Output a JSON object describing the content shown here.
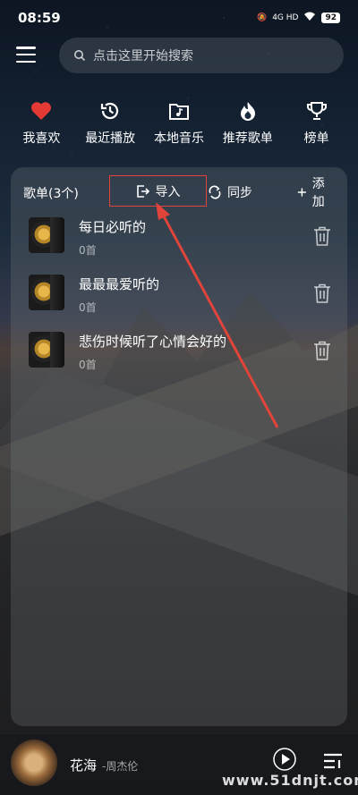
{
  "status": {
    "time": "08:59",
    "network": "4G HD",
    "battery": "92"
  },
  "search": {
    "placeholder": "点击这里开始搜索"
  },
  "quicknav": [
    {
      "label": "我喜欢",
      "icon": "heart-icon"
    },
    {
      "label": "最近播放",
      "icon": "history-icon"
    },
    {
      "label": "本地音乐",
      "icon": "folder-music-icon"
    },
    {
      "label": "推荐歌单",
      "icon": "flame-icon"
    },
    {
      "label": "榜单",
      "icon": "trophy-icon"
    }
  ],
  "playlists_header": {
    "count_label": "歌单(3个)",
    "import_label": "导入",
    "sync_label": "同步",
    "add_label": "添加"
  },
  "playlists": [
    {
      "name": "每日必听的",
      "count": "0首"
    },
    {
      "name": "最最最爱听的",
      "count": "0首"
    },
    {
      "name": "悲伤时候听了心情会好的",
      "count": "0首"
    }
  ],
  "player": {
    "song": "花海",
    "artist": "-周杰伦"
  },
  "watermark": "www.51dnjt.com",
  "colors": {
    "accent_red": "#e0443a",
    "heart": "#e53935"
  }
}
